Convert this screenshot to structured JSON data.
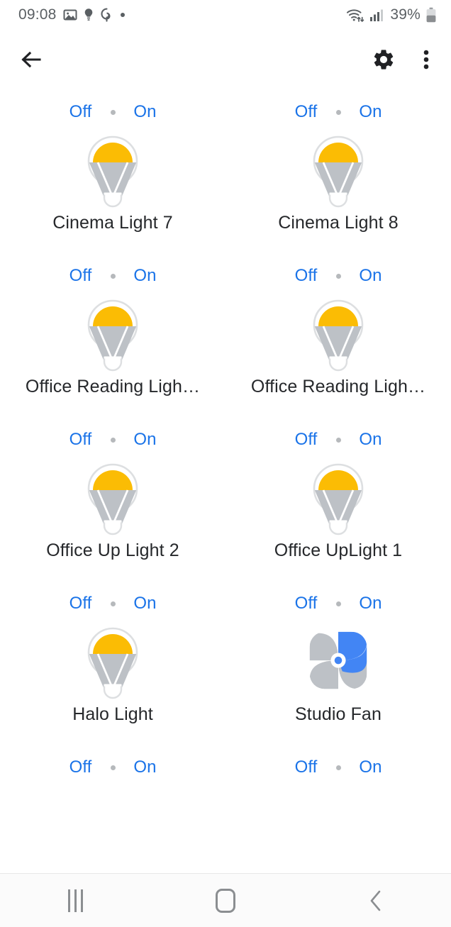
{
  "status_bar": {
    "time": "09:08",
    "left_icons": [
      "image-icon",
      "lightbulb-icon",
      "location-pin-icon",
      "dot-icon"
    ],
    "wifi_icon": "wifi-icon",
    "signal_icon": "cellular-signal-icon",
    "battery_percent": "39%",
    "battery_icon": "battery-icon"
  },
  "app_bar": {
    "back_icon": "back-arrow-icon",
    "settings_icon": "gear-icon",
    "overflow_icon": "more-vertical-icon"
  },
  "labels": {
    "off": "Off",
    "on": "On"
  },
  "colors": {
    "accent_blue": "#1a73e8",
    "bulb_yellow": "#fbbc04",
    "bulb_gray": "#bdc1c6",
    "fan_blue": "#4285f4",
    "fan_gray": "#bdc1c6",
    "text_primary": "#26282b",
    "dot_gray": "#b6b9bc"
  },
  "devices": [
    {
      "name": "Cinema Light 7",
      "icon": "light-bulb-icon",
      "off": "Off",
      "on": "On"
    },
    {
      "name": "Cinema Light 8",
      "icon": "light-bulb-icon",
      "off": "Off",
      "on": "On"
    },
    {
      "name": "Office Reading Ligh…",
      "icon": "light-bulb-icon",
      "off": "Off",
      "on": "On"
    },
    {
      "name": "Office Reading Ligh…",
      "icon": "light-bulb-icon",
      "off": "Off",
      "on": "On"
    },
    {
      "name": "Office Up Light 2",
      "icon": "light-bulb-icon",
      "off": "Off",
      "on": "On"
    },
    {
      "name": "Office UpLight 1",
      "icon": "light-bulb-icon",
      "off": "Off",
      "on": "On"
    },
    {
      "name": "Halo Light",
      "icon": "light-bulb-icon",
      "off": "Off",
      "on": "On"
    },
    {
      "name": "Studio Fan",
      "icon": "fan-icon",
      "off": "Off",
      "on": "On"
    }
  ],
  "trailing_toggles": [
    {
      "off": "Off",
      "on": "On"
    },
    {
      "off": "Off",
      "on": "On"
    }
  ],
  "nav_bar": {
    "recents_icon": "recents-icon",
    "home_icon": "home-icon",
    "back_icon": "back-chevron-icon"
  }
}
